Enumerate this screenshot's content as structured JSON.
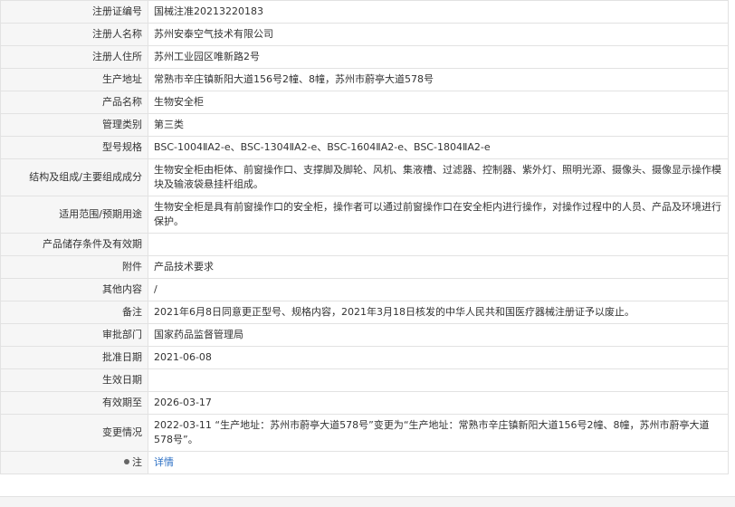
{
  "rows": [
    {
      "label": "注册证编号",
      "value": "国械注准20213220183"
    },
    {
      "label": "注册人名称",
      "value": "苏州安泰空气技术有限公司"
    },
    {
      "label": "注册人住所",
      "value": "苏州工业园区唯新路2号"
    },
    {
      "label": "生产地址",
      "value": "常熟市辛庄镇新阳大道156号2幢、8幢，苏州市蔚亭大道578号"
    },
    {
      "label": "产品名称",
      "value": "生物安全柜"
    },
    {
      "label": "管理类别",
      "value": "第三类"
    },
    {
      "label": "型号规格",
      "value": "BSC-1004ⅡA2-e、BSC-1304ⅡA2-e、BSC-1604ⅡA2-e、BSC-1804ⅡA2-e"
    },
    {
      "label": "结构及组成/主要组成成分",
      "value": "生物安全柜由柜体、前窗操作口、支撑脚及脚轮、风机、集液槽、过滤器、控制器、紫外灯、照明光源、摄像头、摄像显示操作模块及输液袋悬挂杆组成。"
    },
    {
      "label": "适用范围/预期用途",
      "value": "生物安全柜是具有前窗操作口的安全柜，操作者可以通过前窗操作口在安全柜内进行操作，对操作过程中的人员、产品及环境进行保护。"
    },
    {
      "label": "产品储存条件及有效期",
      "value": ""
    },
    {
      "label": "附件",
      "value": "产品技术要求"
    },
    {
      "label": "其他内容",
      "value": "/"
    },
    {
      "label": "备注",
      "value": "2021年6月8日同意更正型号、规格内容，2021年3月18日核发的中华人民共和国医疗器械注册证予以废止。"
    },
    {
      "label": "审批部门",
      "value": "国家药品监督管理局"
    },
    {
      "label": "批准日期",
      "value": "2021-06-08"
    },
    {
      "label": "生效日期",
      "value": ""
    },
    {
      "label": "有效期至",
      "value": "2026-03-17"
    },
    {
      "label": "变更情况",
      "value": "2022-03-11  “生产地址：苏州市蔚亭大道578号”变更为“生产地址：常熟市辛庄镇新阳大道156号2幢、8幢，苏州市蔚亭大道578号”。"
    }
  ],
  "note": {
    "label": "注",
    "link_text": "详情",
    "icon": "pin-icon"
  }
}
